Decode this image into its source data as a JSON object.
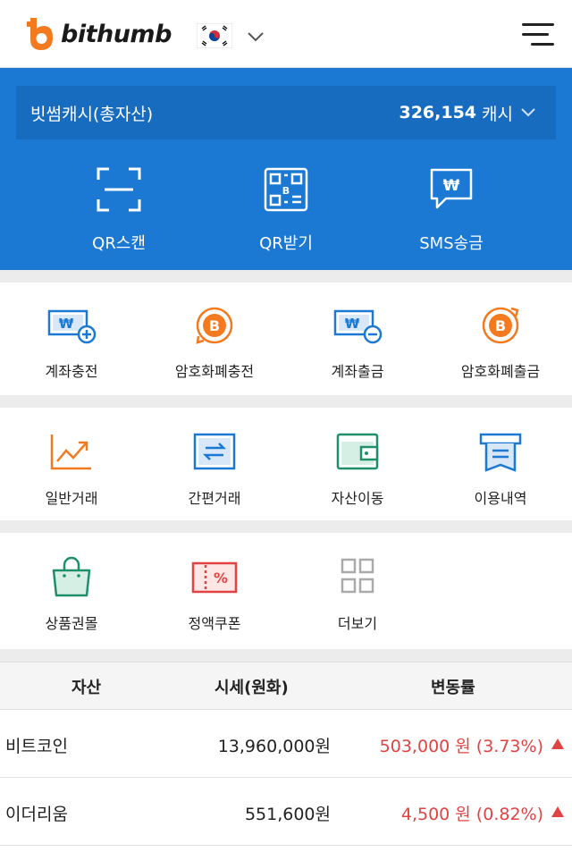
{
  "header": {
    "logo_text": "bithumb"
  },
  "cash": {
    "label": "빗썸캐시(총자산)",
    "amount": "326,154",
    "unit": "캐시"
  },
  "blue_actions": [
    {
      "label": "QR스캔",
      "icon": "qr-scan-icon"
    },
    {
      "label": "QR받기",
      "icon": "qr-code-icon"
    },
    {
      "label": "SMS송금",
      "icon": "sms-won-icon"
    }
  ],
  "grid_row1": [
    {
      "label": "계좌충전",
      "icon": "account-deposit-icon"
    },
    {
      "label": "암호화폐충전",
      "icon": "crypto-deposit-icon"
    },
    {
      "label": "계좌출금",
      "icon": "account-withdraw-icon"
    },
    {
      "label": "암호화폐출금",
      "icon": "crypto-withdraw-icon"
    }
  ],
  "grid_row2": [
    {
      "label": "일반거래",
      "icon": "chart-trend-icon"
    },
    {
      "label": "간편거래",
      "icon": "exchange-arrows-icon"
    },
    {
      "label": "자산이동",
      "icon": "wallet-icon"
    },
    {
      "label": "이용내역",
      "icon": "receipt-icon"
    }
  ],
  "grid_row3": [
    {
      "label": "상품권몰",
      "icon": "shopping-bag-icon"
    },
    {
      "label": "정액쿠폰",
      "icon": "coupon-icon"
    },
    {
      "label": "더보기",
      "icon": "more-grid-icon"
    }
  ],
  "table": {
    "headers": [
      "자산",
      "시세(원화)",
      "변동률"
    ],
    "rows": [
      {
        "name": "비트코인",
        "price": "13,960,000원",
        "change": "503,000 원 (3.73%)"
      },
      {
        "name": "이더리움",
        "price": "551,600원",
        "change": "4,500 원 (0.82%)"
      }
    ]
  },
  "colors": {
    "brand_blue": "#1b79d3",
    "brand_orange": "#f47a1f",
    "positive_red": "#e14343"
  }
}
